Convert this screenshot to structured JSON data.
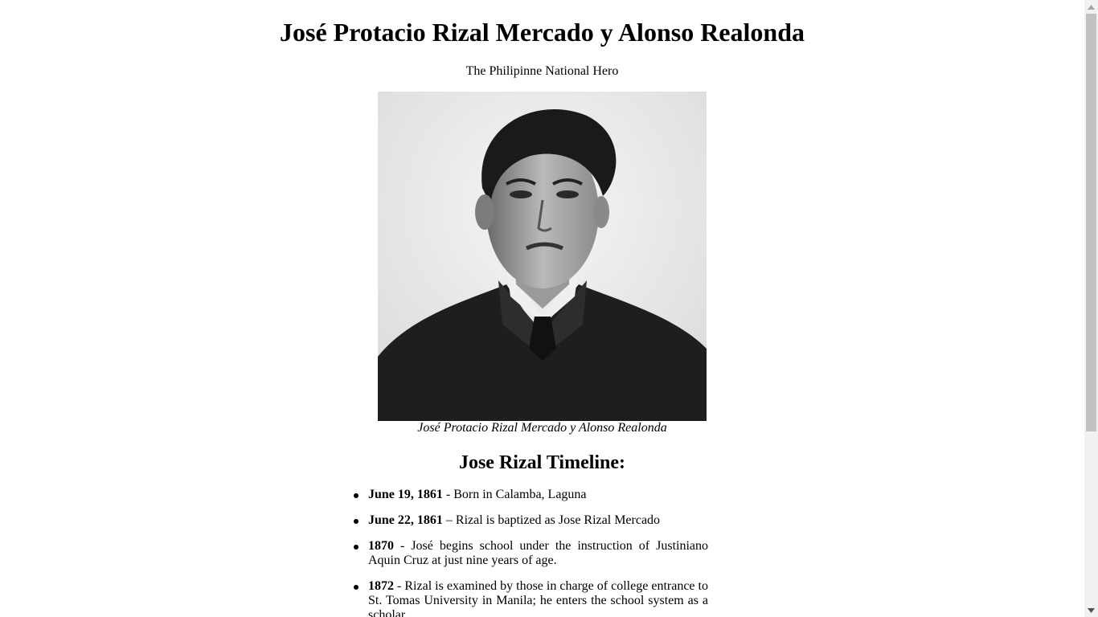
{
  "page": {
    "title": "José Protacio Rizal Mercado y Alonso Realonda",
    "subtitle": "The Philipinne National Hero"
  },
  "figure": {
    "caption": "José Protacio Rizal Mercado y Alonso Realonda"
  },
  "timeline": {
    "heading": "Jose Rizal Timeline:",
    "items": [
      {
        "date": "June 19, 1861",
        "text": " - Born in Calamba, Laguna"
      },
      {
        "date": "June 22, 1861",
        "text": " – Rizal is baptized as Jose Rizal Mercado"
      },
      {
        "date": "1870",
        "text": " - José begins school under the instruction of Justiniano Aquin Cruz at just nine years of age."
      },
      {
        "date": "1872",
        "text": " - Rizal is examined by those in charge of college entrance to St. Tomas University in Manila; he enters the school system as a scholar."
      }
    ]
  },
  "icons": {
    "scroll_up": "triangle-up-icon",
    "scroll_down": "triangle-down-icon"
  }
}
